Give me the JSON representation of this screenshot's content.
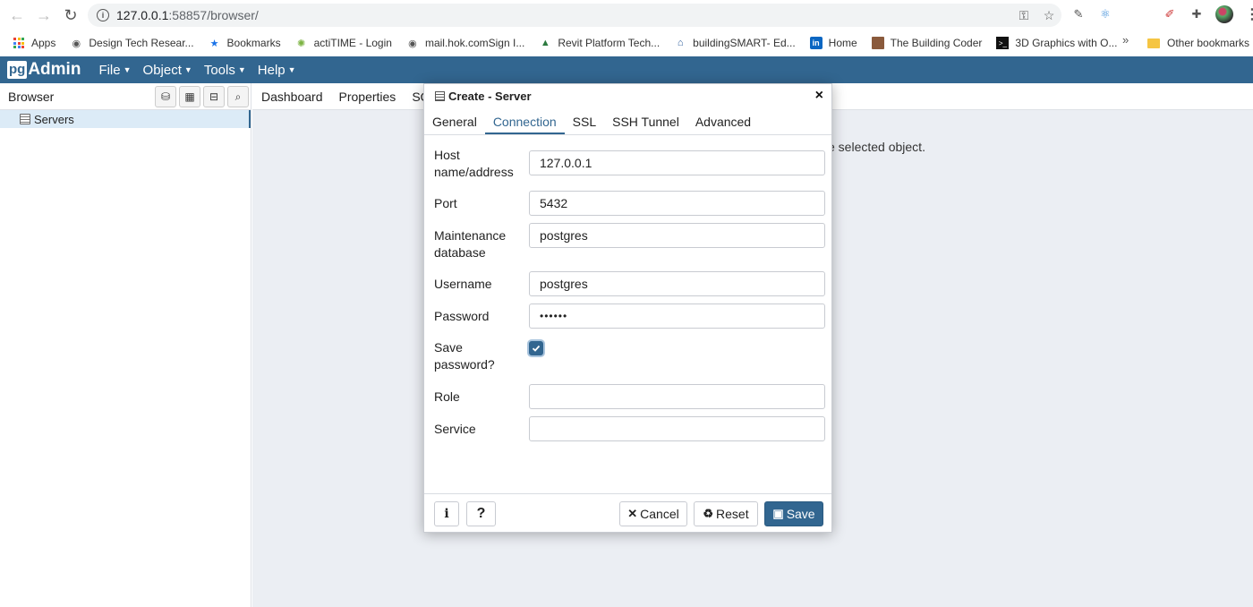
{
  "chrome": {
    "url_host": "127.0.0.1",
    "url_rest": ":58857/browser/",
    "bookmarks": [
      {
        "label": "Apps",
        "icon": "apps-grid-icon"
      },
      {
        "label": "Design Tech Resear...",
        "icon": "globe-icon"
      },
      {
        "label": "Bookmarks",
        "icon": "star-icon"
      },
      {
        "label": "actiTIME - Login",
        "icon": "actitime-icon"
      },
      {
        "label": "mail.hok.comSign I...",
        "icon": "globe-icon"
      },
      {
        "label": "Revit Platform Tech...",
        "icon": "autodesk-icon"
      },
      {
        "label": "buildingSMART- Ed...",
        "icon": "buildingsmart-icon"
      },
      {
        "label": "Home",
        "icon": "linkedin-icon"
      },
      {
        "label": "The Building Coder",
        "icon": "portrait-icon"
      },
      {
        "label": "3D Graphics with O...",
        "icon": "terminal-icon"
      }
    ],
    "more": "»",
    "other_bookmarks": "Other bookmarks"
  },
  "pgadmin": {
    "logo_pg": "pg",
    "logo_admin": "Admin",
    "menu": [
      "File",
      "Object",
      "Tools",
      "Help"
    ]
  },
  "browser": {
    "title": "Browser",
    "tree_item": "Servers"
  },
  "main": {
    "tabs": [
      "Dashboard",
      "Properties",
      "SQL"
    ],
    "hint": "e selected object."
  },
  "dialog": {
    "title": "Create - Server",
    "close": "×",
    "tabs": [
      "General",
      "Connection",
      "SSL",
      "SSH Tunnel",
      "Advanced"
    ],
    "active_tab": "Connection",
    "fields": {
      "host_label": "Host name/address",
      "host_value": "127.0.0.1",
      "port_label": "Port",
      "port_value": "5432",
      "maint_label": "Maintenance database",
      "maint_value": "postgres",
      "user_label": "Username",
      "user_value": "postgres",
      "password_label": "Password",
      "password_value": "••••••",
      "save_pw_label": "Save password?",
      "save_pw_checked": true,
      "role_label": "Role",
      "role_value": "",
      "service_label": "Service",
      "service_value": ""
    },
    "footer": {
      "info": "i",
      "help": "?",
      "cancel": "Cancel",
      "reset": "Reset",
      "save": "Save"
    }
  },
  "colors": {
    "brand": "#326690",
    "main_bg": "#ebeef3"
  }
}
